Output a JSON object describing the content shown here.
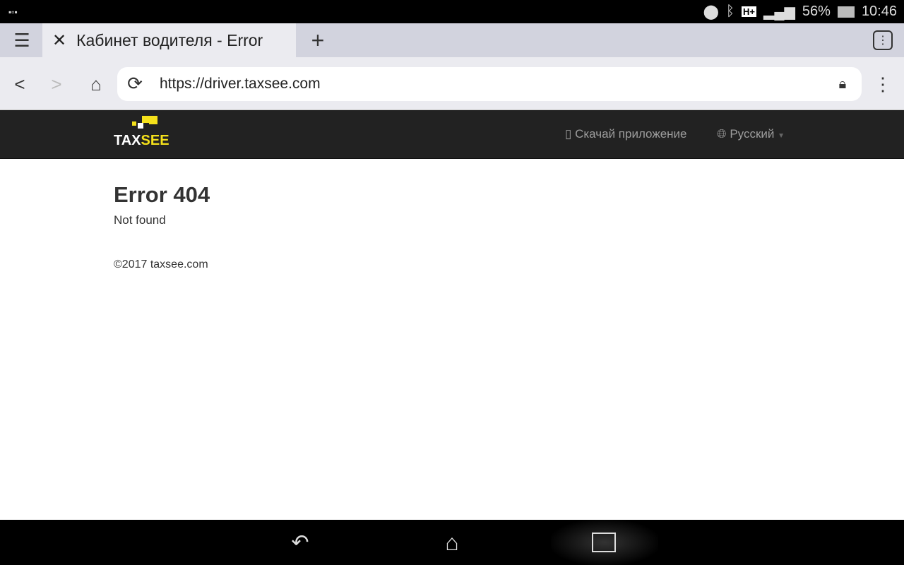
{
  "status_bar": {
    "battery": "56%",
    "time": "10:46",
    "network": "H+"
  },
  "browser": {
    "tab_title": "Кабинет водителя - Error",
    "url": "https://driver.taxsee.com"
  },
  "site": {
    "logo_text_1": "TAX",
    "logo_text_2": "SEE",
    "download_app": "Скачай приложение",
    "language": "Русский",
    "accent": "#f5e11b"
  },
  "content": {
    "title": "Error 404",
    "message": "Not found",
    "footer": "©2017 taxsee.com"
  }
}
